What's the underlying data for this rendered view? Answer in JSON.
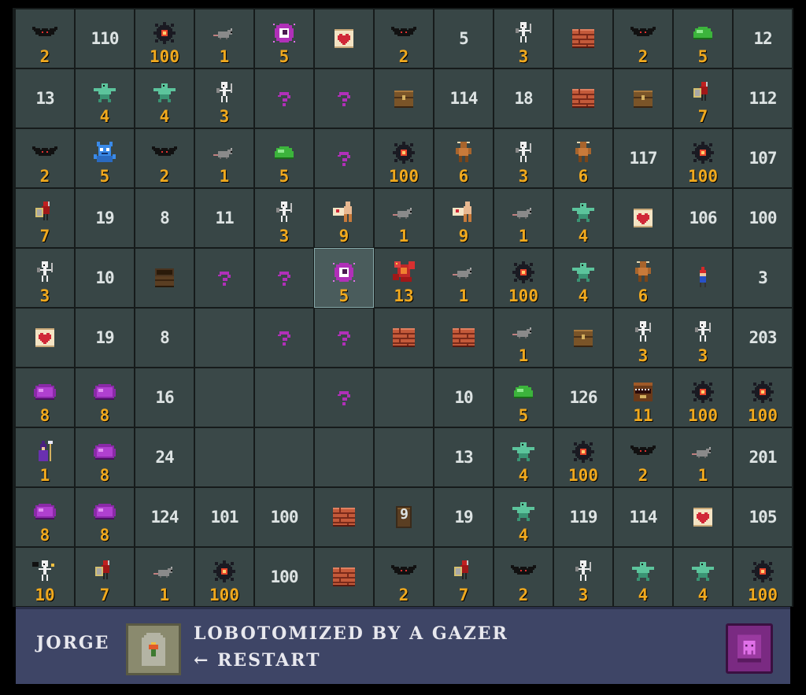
{
  "grid": {
    "rows": [
      [
        {
          "icon": "bat",
          "level": "2"
        },
        {
          "number": "110"
        },
        {
          "icon": "mine",
          "level": "100"
        },
        {
          "icon": "rat",
          "level": "1"
        },
        {
          "icon": "gazer",
          "level": "5"
        },
        {
          "icon": "heart-scroll"
        },
        {
          "icon": "bat",
          "level": "2"
        },
        {
          "number": "5"
        },
        {
          "icon": "skeleton",
          "level": "3"
        },
        {
          "icon": "wall"
        },
        {
          "icon": "bat",
          "level": "2"
        },
        {
          "icon": "green-slime",
          "level": "5"
        },
        {
          "number": "12"
        }
      ],
      [
        {
          "number": "13"
        },
        {
          "icon": "ghoul",
          "level": "4"
        },
        {
          "icon": "ghoul",
          "level": "4"
        },
        {
          "icon": "skeleton",
          "level": "3"
        },
        {
          "icon": "unknown"
        },
        {
          "icon": "unknown"
        },
        {
          "icon": "chest"
        },
        {
          "number": "114"
        },
        {
          "number": "18"
        },
        {
          "icon": "wall"
        },
        {
          "icon": "chest"
        },
        {
          "icon": "guard",
          "level": "7"
        },
        {
          "number": "112"
        }
      ],
      [
        {
          "icon": "bat",
          "level": "2"
        },
        {
          "icon": "blue-imp",
          "level": "5"
        },
        {
          "icon": "bat",
          "level": "2"
        },
        {
          "icon": "rat",
          "level": "1"
        },
        {
          "icon": "green-slime",
          "level": "5"
        },
        {
          "icon": "unknown"
        },
        {
          "icon": "mine",
          "level": "100"
        },
        {
          "icon": "minotaur",
          "level": "6"
        },
        {
          "icon": "skeleton",
          "level": "3"
        },
        {
          "icon": "minotaur",
          "level": "6"
        },
        {
          "number": "117"
        },
        {
          "icon": "mine",
          "level": "100"
        },
        {
          "number": "107"
        }
      ],
      [
        {
          "icon": "guard",
          "level": "7"
        },
        {
          "number": "19"
        },
        {
          "number": "8"
        },
        {
          "number": "11"
        },
        {
          "icon": "skeleton",
          "level": "3"
        },
        {
          "icon": "giant",
          "level": "9"
        },
        {
          "icon": "rat",
          "level": "1"
        },
        {
          "icon": "giant",
          "level": "9"
        },
        {
          "icon": "rat",
          "level": "1"
        },
        {
          "icon": "ghoul",
          "level": "4"
        },
        {
          "icon": "heart-scroll"
        },
        {
          "number": "106"
        },
        {
          "number": "100"
        }
      ],
      [
        {
          "icon": "skeleton",
          "level": "3"
        },
        {
          "number": "10"
        },
        {
          "icon": "open-chest"
        },
        {
          "icon": "unknown"
        },
        {
          "icon": "unknown"
        },
        {
          "icon": "gazer",
          "level": "5",
          "highlight": "yes"
        },
        {
          "icon": "dragon",
          "level": "13"
        },
        {
          "icon": "rat",
          "level": "1"
        },
        {
          "icon": "mine",
          "level": "100"
        },
        {
          "icon": "ghoul",
          "level": "4"
        },
        {
          "icon": "minotaur",
          "level": "6"
        },
        {
          "icon": "gnome"
        },
        {
          "number": "3"
        }
      ],
      [
        {
          "icon": "heart-scroll"
        },
        {
          "number": "19"
        },
        {
          "number": "8"
        },
        {
          "empty": "yes"
        },
        {
          "icon": "unknown"
        },
        {
          "icon": "unknown"
        },
        {
          "icon": "wall"
        },
        {
          "icon": "wall"
        },
        {
          "icon": "rat",
          "level": "1"
        },
        {
          "icon": "chest"
        },
        {
          "icon": "skeleton",
          "level": "3"
        },
        {
          "icon": "skeleton",
          "level": "3"
        },
        {
          "number": "203"
        }
      ],
      [
        {
          "icon": "purple-slime",
          "level": "8"
        },
        {
          "icon": "purple-slime",
          "level": "8"
        },
        {
          "number": "16"
        },
        {
          "empty": "yes"
        },
        {
          "empty": "yes"
        },
        {
          "icon": "unknown"
        },
        {
          "empty": "yes"
        },
        {
          "number": "10"
        },
        {
          "icon": "green-slime",
          "level": "5"
        },
        {
          "number": "126"
        },
        {
          "icon": "mimic",
          "level": "11"
        },
        {
          "icon": "mine",
          "level": "100"
        },
        {
          "icon": "mine",
          "level": "100"
        }
      ],
      [
        {
          "icon": "wizard",
          "level": "1"
        },
        {
          "icon": "purple-slime",
          "level": "8"
        },
        {
          "number": "24"
        },
        {
          "empty": "yes"
        },
        {
          "empty": "yes"
        },
        {
          "empty": "yes"
        },
        {
          "empty": "yes"
        },
        {
          "number": "13"
        },
        {
          "icon": "ghoul",
          "level": "4"
        },
        {
          "icon": "mine",
          "level": "100"
        },
        {
          "icon": "bat",
          "level": "2"
        },
        {
          "icon": "rat",
          "level": "1"
        },
        {
          "number": "201"
        }
      ],
      [
        {
          "icon": "purple-slime",
          "level": "8"
        },
        {
          "icon": "purple-slime",
          "level": "8"
        },
        {
          "number": "124"
        },
        {
          "number": "101"
        },
        {
          "number": "100"
        },
        {
          "icon": "wall"
        },
        {
          "icon": "door",
          "overlay": "9"
        },
        {
          "number": "19"
        },
        {
          "icon": "ghoul",
          "level": "4"
        },
        {
          "number": "119"
        },
        {
          "number": "114"
        },
        {
          "icon": "heart-scroll"
        },
        {
          "number": "105"
        }
      ],
      [
        {
          "icon": "bat-skeleton",
          "level": "10"
        },
        {
          "icon": "guard",
          "level": "7"
        },
        {
          "icon": "rat",
          "level": "1"
        },
        {
          "icon": "mine",
          "level": "100"
        },
        {
          "number": "100"
        },
        {
          "icon": "wall"
        },
        {
          "icon": "bat",
          "level": "2"
        },
        {
          "icon": "guard",
          "level": "7"
        },
        {
          "icon": "bat",
          "level": "2"
        },
        {
          "icon": "skeleton",
          "level": "3"
        },
        {
          "icon": "ghoul",
          "level": "4"
        },
        {
          "icon": "ghoul",
          "level": "4"
        },
        {
          "icon": "mine",
          "level": "100"
        }
      ]
    ]
  },
  "footer": {
    "hero_name": "JORGE",
    "death_message": "LOBOTOMIZED BY A GAZER",
    "restart_label": "← RESTART",
    "tombstone_icon": "tombstone-icon",
    "book_icon": "monster-book-icon"
  },
  "colors": {
    "level": "#f0a91e",
    "number": "#dde3e3",
    "cell": "#384646",
    "footer": "#3e4566"
  }
}
